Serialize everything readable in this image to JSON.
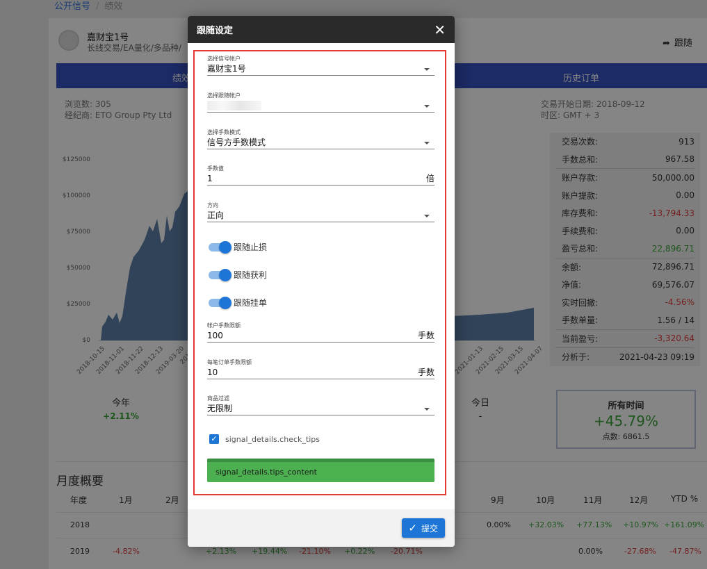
{
  "background": {
    "breadcrumb": {
      "link": "公开信号",
      "current": "绩效"
    },
    "signal": {
      "name": "嘉财宝1号",
      "tags": "长线交易/EA量化/多品种/"
    },
    "follow_label": "跟随",
    "tabs": {
      "performance": "绩效",
      "history": "历史订单"
    },
    "meta_left": {
      "views": "浏览数: 305",
      "broker": "经纪商: ETO Group Pty Ltd"
    },
    "meta_right": {
      "start": "交易开始日期: 2018-09-12",
      "tz": "时区: GMT + 3"
    },
    "chart_data": {
      "type": "area",
      "y_ticks": [
        "$125000",
        "$100000",
        "$75000",
        "$50000",
        "$25000",
        "$0"
      ],
      "x_ticks": [
        "2018-10-15",
        "2018-11-01",
        "2018-11-22",
        "2018-12-13",
        "2019-03-20",
        "2019-0",
        "2021-01-13",
        "2021-02-15",
        "2021-03-15",
        "2021-04-07"
      ],
      "color": "#5f81ab"
    },
    "stats": [
      {
        "k": "交易次数:",
        "v": "913",
        "c": ""
      },
      {
        "k": "手数总和:",
        "v": "967.58",
        "c": ""
      },
      {
        "k": "账户存款:",
        "v": "50,000.00",
        "c": ""
      },
      {
        "k": "账户提款:",
        "v": "0.00",
        "c": ""
      },
      {
        "k": "库存费和:",
        "v": "-13,794.33",
        "c": "red"
      },
      {
        "k": "手续费和:",
        "v": "0.00",
        "c": ""
      },
      {
        "k": "盈亏总和:",
        "v": "22,896.71",
        "c": "green"
      },
      {
        "k": "余额:",
        "v": "72,896.71",
        "c": ""
      },
      {
        "k": "净值:",
        "v": "69,576.07",
        "c": ""
      },
      {
        "k": "实时回撤:",
        "v": "-4.56%",
        "c": "red"
      },
      {
        "k": "手数单量:",
        "v": "1.56 / 14",
        "c": ""
      },
      {
        "k": "当前盈亏:",
        "v": "-3,320.64",
        "c": "red"
      },
      {
        "k": "分析于:",
        "v": "2021-04-23 09:19",
        "c": ""
      }
    ],
    "alltime": {
      "title": "所有时间",
      "percent": "+45.79%",
      "points": "点数: 6861.5"
    },
    "year": {
      "label": "今年",
      "value": "+2.11%"
    },
    "today": {
      "label": "今日",
      "value": "-"
    },
    "monthly": {
      "title": "月度概要",
      "headers": [
        "年度",
        "1月",
        "2月",
        "9月",
        "10月",
        "11月",
        "12月",
        "YTD %"
      ],
      "row2018": {
        "year": "2018",
        "sep": "0.00%",
        "oct": "+32.03%",
        "nov": "+77.13%",
        "dec": "+10.97%",
        "ytd": "+161.09%"
      },
      "row2019": {
        "year": "2019",
        "jan": "-4.82%",
        "c3": "+2.13%",
        "c4": "+19.44%",
        "c5": "-21.10%",
        "c6": "+0.22%",
        "c7": "-20.71%",
        "nov": "0.00%",
        "dec": "-27.68%",
        "ytd": "-47.87%"
      }
    }
  },
  "dialog": {
    "title": "跟随设定",
    "signal_account": {
      "label": "选择信号帐户",
      "value": "嘉财宝1号"
    },
    "follow_account": {
      "label": "选择跟随帐户",
      "value": ""
    },
    "lot_mode": {
      "label": "选择手数模式",
      "value": "信号方手数模式"
    },
    "lot_value": {
      "label": "手数值",
      "value": "1",
      "unit": "倍"
    },
    "direction": {
      "label": "方向",
      "value": "正向"
    },
    "toggles": {
      "stop_loss": "跟随止损",
      "take_profit": "跟随获利",
      "pending": "跟随挂单"
    },
    "account_lot_limit": {
      "label": "帐户手数限额",
      "value": "100",
      "unit": "手数"
    },
    "order_lot_limit": {
      "label": "每笔订单手数限额",
      "value": "10",
      "unit": "手数"
    },
    "product_filter": {
      "label": "商品过滤",
      "value": "无限制"
    },
    "check_tips": "signal_details.check_tips",
    "tips_content": "signal_details.tips_content",
    "submit": "提交"
  }
}
